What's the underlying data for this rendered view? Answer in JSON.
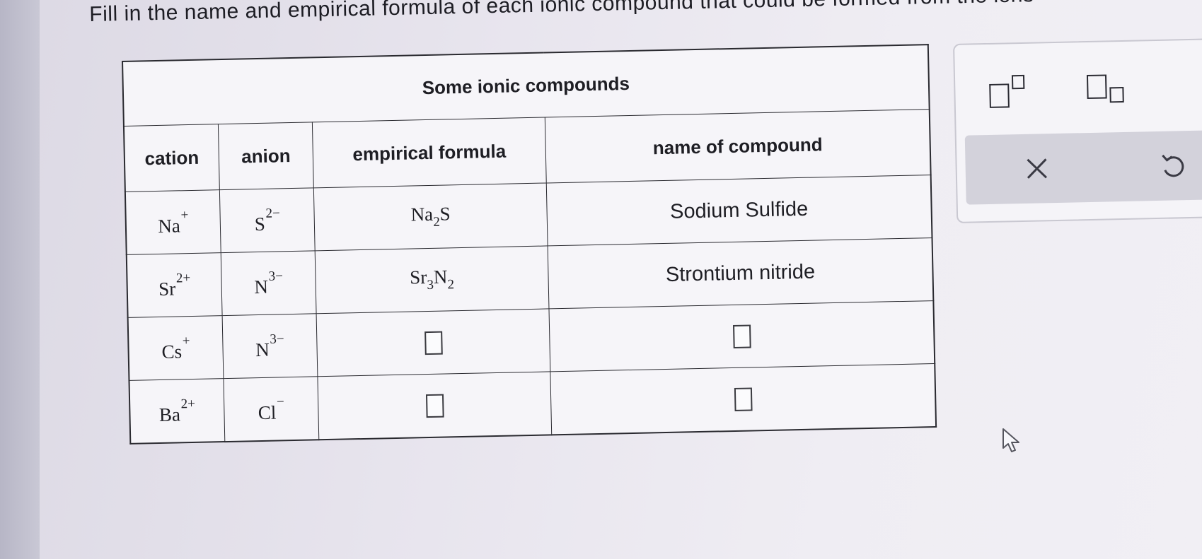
{
  "instruction": "Fill in the name and empirical formula of each ionic compound that could be formed from the ions",
  "table": {
    "caption": "Some ionic compounds",
    "headers": {
      "cation": "cation",
      "anion": "anion",
      "formula": "empirical formula",
      "name": "name of compound"
    },
    "rows": [
      {
        "cation": {
          "symbol": "Na",
          "charge": "+"
        },
        "anion": {
          "symbol": "S",
          "charge": "2−"
        },
        "formula": [
          {
            "el": "Na",
            "n": "2"
          },
          {
            "el": "S",
            "n": ""
          }
        ],
        "name": "Sodium Sulfide"
      },
      {
        "cation": {
          "symbol": "Sr",
          "charge": "2+"
        },
        "anion": {
          "symbol": "N",
          "charge": "3−"
        },
        "formula": [
          {
            "el": "Sr",
            "n": "3"
          },
          {
            "el": "N",
            "n": "2"
          }
        ],
        "name": "Strontium nitride"
      },
      {
        "cation": {
          "symbol": "Cs",
          "charge": "+"
        },
        "anion": {
          "symbol": "N",
          "charge": "3−"
        },
        "formula": null,
        "name": null
      },
      {
        "cation": {
          "symbol": "Ba",
          "charge": "2+"
        },
        "anion": {
          "symbol": "Cl",
          "charge": "−"
        },
        "formula": null,
        "name": null
      }
    ]
  },
  "toolbar": {
    "superscript_icon": "superscript-icon",
    "subscript_icon": "subscript-icon",
    "clear_icon": "x-icon",
    "undo_icon": "undo-icon"
  },
  "colors": {
    "background": "#ebe8f0",
    "table_border": "#2a2a30",
    "action_bar": "#d3d2db"
  }
}
